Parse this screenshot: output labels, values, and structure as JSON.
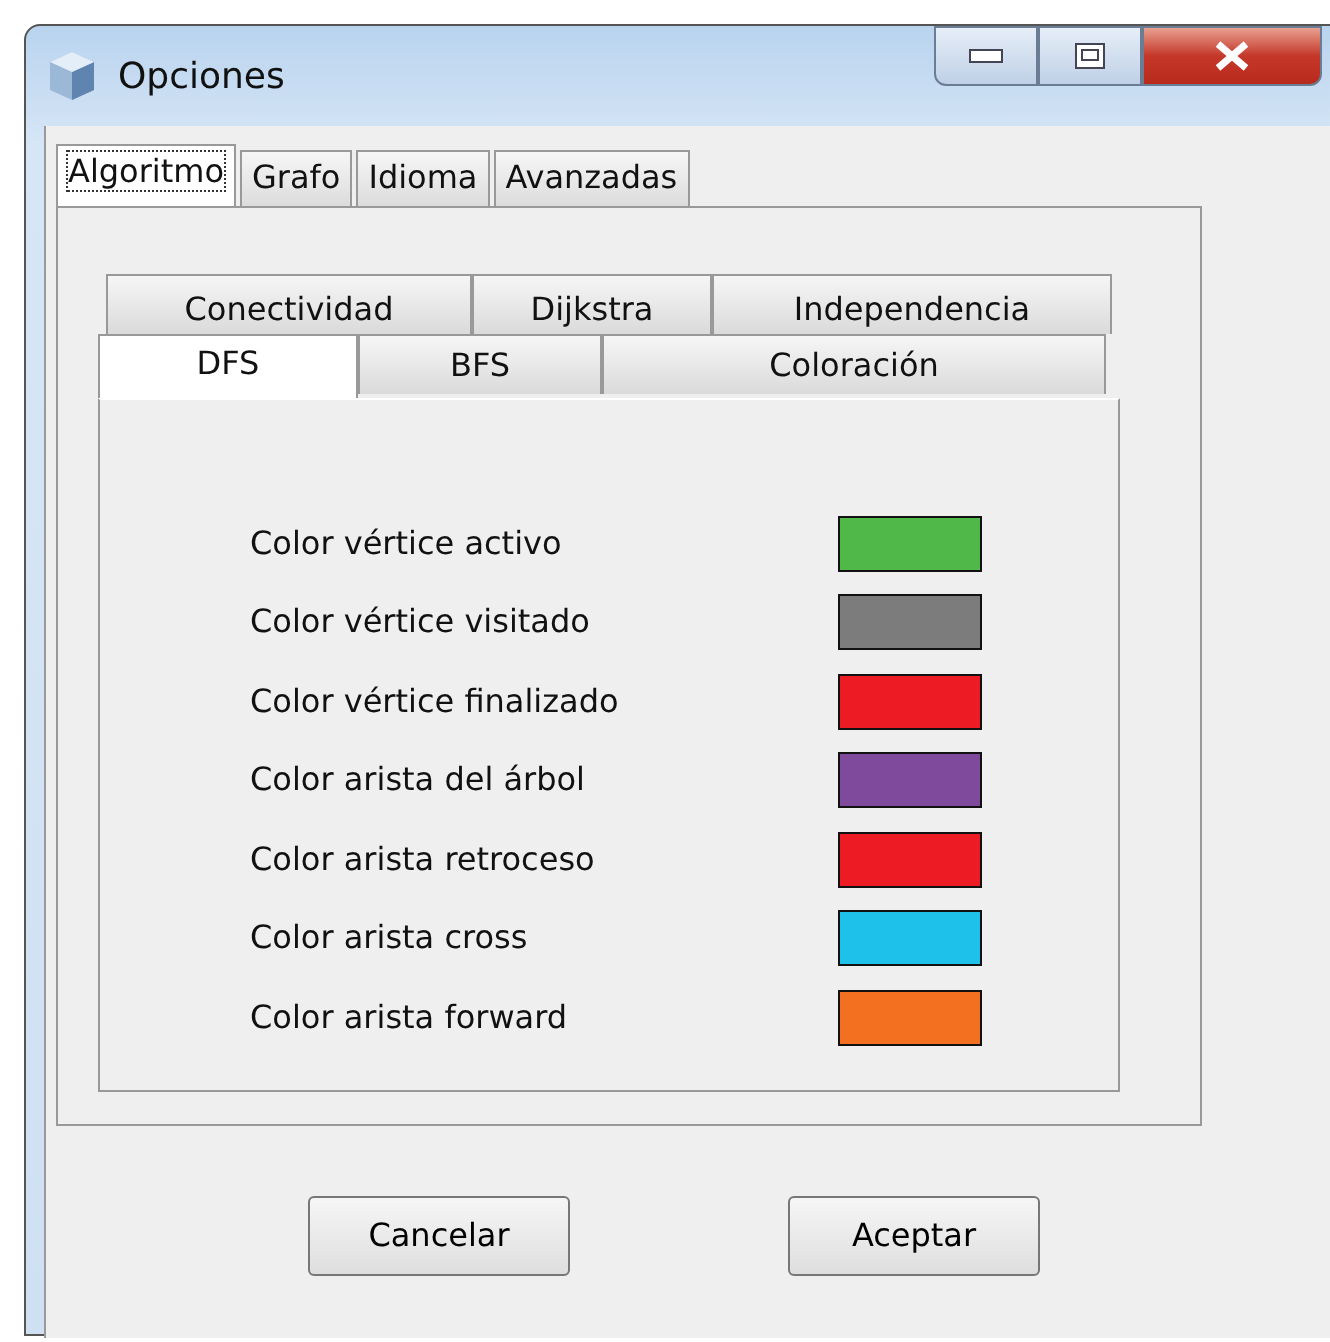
{
  "window": {
    "title": "Opciones"
  },
  "tabs": [
    {
      "label": "Algoritmo",
      "selected": true
    },
    {
      "label": "Grafo",
      "selected": false
    },
    {
      "label": "Idioma",
      "selected": false
    },
    {
      "label": "Avanzadas",
      "selected": false
    }
  ],
  "algorithm_tabs": [
    [
      {
        "label": "Conectividad",
        "selected": false
      },
      {
        "label": "Dijkstra",
        "selected": false
      },
      {
        "label": "Independencia",
        "selected": false
      }
    ],
    [
      {
        "label": "DFS",
        "selected": true
      },
      {
        "label": "BFS",
        "selected": false
      },
      {
        "label": "Coloración",
        "selected": false
      }
    ]
  ],
  "colors": [
    {
      "label": "Color vértice activo",
      "color": "#50b848"
    },
    {
      "label": "Color vértice visitado",
      "color": "#7c7c7c"
    },
    {
      "label": "Color vértice finalizado",
      "color": "#ed1c24"
    },
    {
      "label": "Color arista del árbol",
      "color": "#804a9c"
    },
    {
      "label": "Color arista retroceso",
      "color": "#ed1c24"
    },
    {
      "label": "Color arista cross",
      "color": "#1ec1ea"
    },
    {
      "label": "Color arista forward",
      "color": "#f37021"
    }
  ],
  "buttons": [
    "Cancelar",
    "Aceptar"
  ]
}
